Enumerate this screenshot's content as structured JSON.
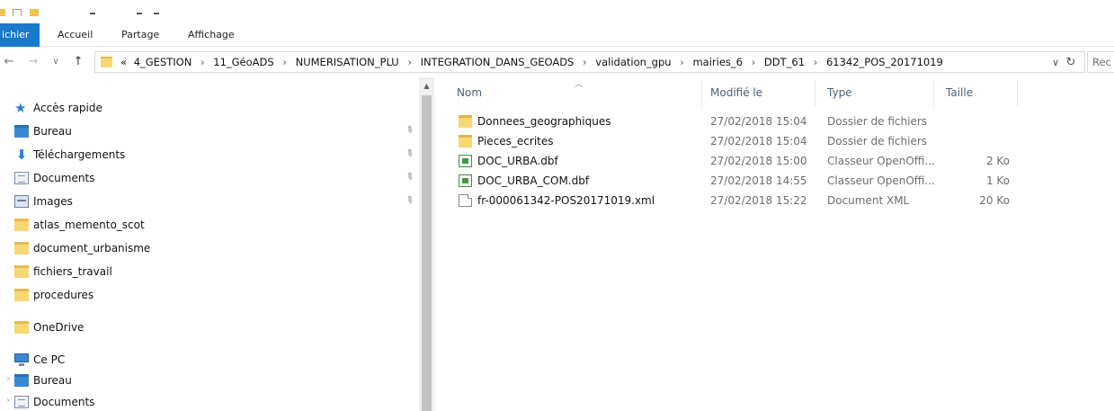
{
  "ribbon": {
    "file_tab": "ichier",
    "tabs": [
      "Accueil",
      "Partage",
      "Affichage"
    ]
  },
  "address": {
    "overflow": "«",
    "crumbs": [
      "4_GESTION",
      "11_GéoADS",
      "NUMERISATION_PLU",
      "INTEGRATION_DANS_GEOADS",
      "validation_gpu",
      "mairies_6",
      "DDT_61",
      "61342_POS_20171019"
    ],
    "separator": "›",
    "search_placeholder": "Rec"
  },
  "nav": {
    "quick_access": "Accès rapide",
    "pinned": [
      {
        "label": "Bureau",
        "icon": "desktop-icon"
      },
      {
        "label": "Téléchargements",
        "icon": "download-icon"
      },
      {
        "label": "Documents",
        "icon": "documents-icon"
      },
      {
        "label": "Images",
        "icon": "pictures-icon"
      }
    ],
    "folders": [
      "atlas_memento_scot",
      "document_urbanisme",
      "fichiers_travail",
      "procedures"
    ],
    "onedrive": "OneDrive",
    "this_pc": "Ce PC",
    "pc_items": [
      "Bureau",
      "Documents"
    ]
  },
  "columns": {
    "name": "Nom",
    "modified": "Modifié le",
    "type": "Type",
    "size": "Taille"
  },
  "files": [
    {
      "name": "Donnees_geographiques",
      "modified": "27/02/2018 15:04",
      "type": "Dossier de fichiers",
      "size": "",
      "icon": "folder-icon"
    },
    {
      "name": "Pieces_ecrites",
      "modified": "27/02/2018 15:04",
      "type": "Dossier de fichiers",
      "size": "",
      "icon": "folder-icon"
    },
    {
      "name": "DOC_URBA.dbf",
      "modified": "27/02/2018 15:00",
      "type": "Classeur OpenOffi...",
      "size": "2 Ko",
      "icon": "spreadsheet-icon"
    },
    {
      "name": "DOC_URBA_COM.dbf",
      "modified": "27/02/2018 14:55",
      "type": "Classeur OpenOffi...",
      "size": "1 Ko",
      "icon": "spreadsheet-icon"
    },
    {
      "name": "fr-000061342-POS20171019.xml",
      "modified": "27/02/2018 15:22",
      "type": "Document XML",
      "size": "20 Ko",
      "icon": "xml-file-icon"
    }
  ]
}
